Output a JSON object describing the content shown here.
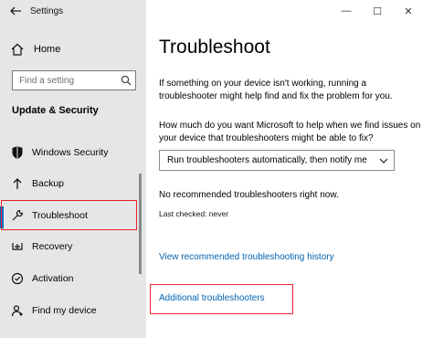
{
  "window": {
    "app_title": "Settings",
    "minimize_glyph": "—",
    "maximize_glyph": "☐",
    "close_glyph": "✕"
  },
  "sidebar": {
    "home_label": "Home",
    "search_placeholder": "Find a setting",
    "section_title": "Update & Security",
    "items": [
      {
        "label": "Windows Security",
        "icon": "shield-icon"
      },
      {
        "label": "Backup",
        "icon": "backup-arrow-icon"
      },
      {
        "label": "Troubleshoot",
        "icon": "wrench-icon",
        "selected": true
      },
      {
        "label": "Recovery",
        "icon": "recovery-icon"
      },
      {
        "label": "Activation",
        "icon": "activation-check-icon"
      },
      {
        "label": "Find my device",
        "icon": "person-location-icon"
      }
    ]
  },
  "main": {
    "title": "Troubleshoot",
    "intro": "If something on your device isn't working, running a troubleshooter might help find and fix the problem for you.",
    "question": "How much do you want Microsoft to help when we find issues on your device that troubleshooters might be able to fix?",
    "dropdown_value": "Run troubleshooters automatically, then notify me",
    "no_recommended": "No recommended troubleshooters right now.",
    "last_checked": "Last checked: never",
    "history_link": "View recommended troubleshooting history",
    "additional_link": "Additional troubleshooters"
  },
  "colors": {
    "accent": "#0067c0",
    "link": "#0063b1",
    "highlight_box": "#e8222b",
    "sidebar_bg": "#e6e6e6"
  }
}
